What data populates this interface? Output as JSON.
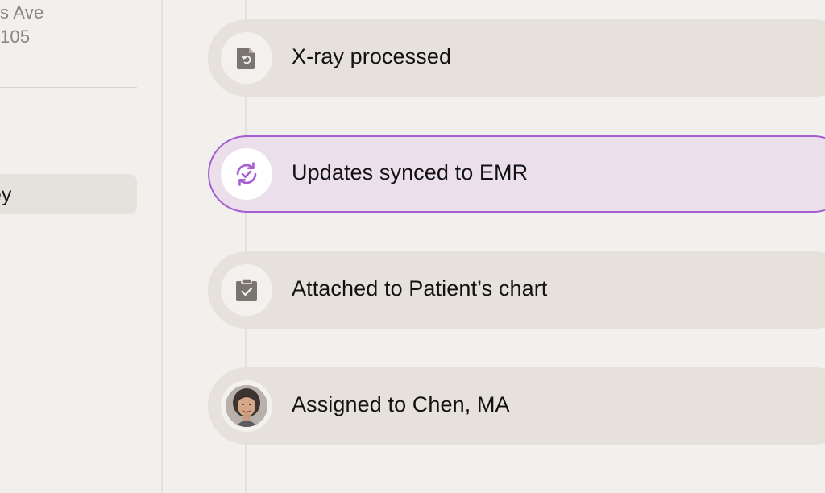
{
  "sidebar": {
    "address_line1": "s Ave",
    "address_line2": "105",
    "active_item_label": "ey"
  },
  "timeline": {
    "events": [
      {
        "label": "X-ray processed",
        "icon": "document-refresh-icon"
      },
      {
        "label": "Updates synced to EMR",
        "icon": "sync-check-icon",
        "active": true
      },
      {
        "label": "Attached to Patient’s chart",
        "icon": "clipboard-check-icon"
      },
      {
        "label": "Assigned to Chen, MA",
        "icon": "avatar"
      }
    ]
  },
  "colors": {
    "accent": "#a65fd2",
    "active_bg": "#eadfea",
    "pill_bg": "#e6e1db",
    "page_bg": "#f1f0ed",
    "icon_gray": "#7a7571"
  }
}
